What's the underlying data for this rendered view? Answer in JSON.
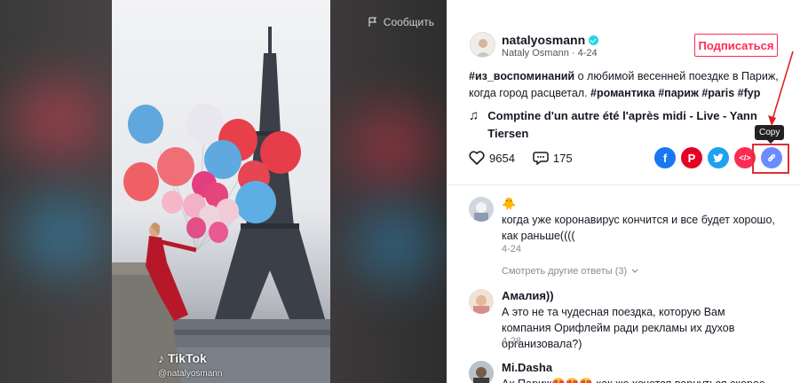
{
  "video": {
    "report_label": "Сообщить",
    "watermark_brand": "TikTok",
    "watermark_user": "@natalyosmann"
  },
  "author": {
    "username": "natalyosmann",
    "display_name": "Nataly Osmann",
    "date": "4-24",
    "follow_label": "Подписаться"
  },
  "description": {
    "tag1": "#из_воспоминаний",
    "text": " о любимой весенней поездке в Париж, когда город расцветал. ",
    "tag2": "#романтика",
    "tag3": "#париж",
    "tag4": "#paris",
    "tag5": "#fyp"
  },
  "music": {
    "title": "Comptine d'un autre été l'après midi - Live - Yann Tiersen"
  },
  "stats": {
    "likes": "9654",
    "comments": "175"
  },
  "share": {
    "tooltip": "Copy",
    "icons": [
      "facebook-icon",
      "pinterest-icon",
      "twitter-icon",
      "embed-icon",
      "link-icon"
    ],
    "accent": "#fe2c55"
  },
  "comments": [
    {
      "name": "🐥",
      "text": "когда уже коронавирус кончится и все будет хорошо, как раньше((((",
      "date": "4-24"
    },
    {
      "name": "Амалия))",
      "text": "А это не та чудесная поездка, которую Вам компания Орифлейм ради рекламы их духов организовала?)",
      "date": "4-28"
    },
    {
      "name": "Mi.Dasha",
      "text": "Ах Париж😍😍😍 как же хочется вернуться скорее",
      "date": ""
    }
  ],
  "more_replies": "Смотреть другие ответы (3)"
}
